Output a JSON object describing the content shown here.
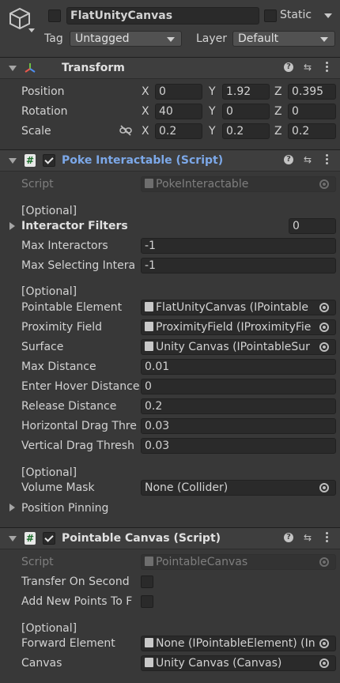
{
  "gameobject": {
    "active": false,
    "name": "FlatUnityCanvas",
    "static_label": "Static",
    "static_checked": false,
    "tag_label": "Tag",
    "tag_value": "Untagged",
    "layer_label": "Layer",
    "layer_value": "Default"
  },
  "transform": {
    "title": "Transform",
    "position_label": "Position",
    "rotation_label": "Rotation",
    "scale_label": "Scale",
    "axis_x": "X",
    "axis_y": "Y",
    "axis_z": "Z",
    "position": {
      "x": "0",
      "y": "1.92",
      "z": "0.395"
    },
    "rotation": {
      "x": "40",
      "y": "0",
      "z": "0"
    },
    "scale": {
      "x": "0.2",
      "y": "0.2",
      "z": "0.2"
    }
  },
  "poke": {
    "title": "Poke Interactable (Script)",
    "enabled": true,
    "script_label": "Script",
    "script_value": "PokeInteractable",
    "optional1": "[Optional]",
    "interactor_filters_label": "Interactor Filters",
    "interactor_filters_value": "0",
    "max_interactors_label": "Max Interactors",
    "max_interactors_value": "-1",
    "max_selecting_label": "Max Selecting Intera",
    "max_selecting_value": "-1",
    "optional2": "[Optional]",
    "pointable_element_label": "Pointable Element",
    "pointable_element_value": "FlatUnityCanvas (IPointable",
    "proximity_field_label": "Proximity Field",
    "proximity_field_value": "ProximityField (IProximityFie",
    "surface_label": "Surface",
    "surface_value": "Unity Canvas (IPointableSur",
    "max_distance_label": "Max Distance",
    "max_distance_value": "0.01",
    "enter_hover_label": "Enter Hover Distance",
    "enter_hover_value": "0",
    "release_distance_label": "Release Distance",
    "release_distance_value": "0.2",
    "horizontal_drag_label": "Horizontal Drag Thre",
    "horizontal_drag_value": "0.03",
    "vertical_drag_label": "Vertical Drag Thresh",
    "vertical_drag_value": "0.03",
    "optional3": "[Optional]",
    "volume_mask_label": "Volume Mask",
    "volume_mask_value": "None (Collider)",
    "position_pinning_label": "Position Pinning"
  },
  "canvas": {
    "title": "Pointable Canvas (Script)",
    "enabled": true,
    "script_label": "Script",
    "script_value": "PointableCanvas",
    "transfer_label": "Transfer On Second",
    "transfer_checked": false,
    "add_points_label": "Add New Points To F",
    "add_points_checked": false,
    "optional": "[Optional]",
    "forward_element_label": "Forward Element",
    "forward_element_value": "None (IPointableElement) (In",
    "canvas_label": "Canvas",
    "canvas_value": "Unity Canvas (Canvas)"
  },
  "colors": {
    "background": "#383838",
    "header": "#3e3e3e",
    "field": "#2a2a2a",
    "title_link": "#7ca8e8"
  }
}
